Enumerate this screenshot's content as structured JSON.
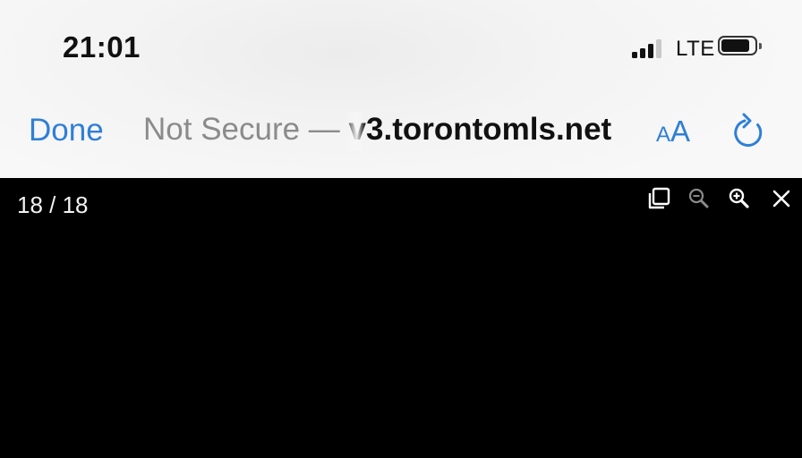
{
  "status_bar": {
    "time": "21:01",
    "network": "LTE",
    "signal_level": 3,
    "signal_max": 4,
    "battery_icon": "battery-icon"
  },
  "browser": {
    "done_label": "Done",
    "url_security_text": "Not Secure — ",
    "url_host": "v3.torontomls.net",
    "text_size_small": "A",
    "text_size_large": "A",
    "reload_icon": "reload-icon",
    "accent_color": "#2f7fd6"
  },
  "viewer": {
    "counter": "18 / 18",
    "toolbar_icons": [
      "copy-icon",
      "zoom-out-icon",
      "zoom-in-icon",
      "close-icon"
    ],
    "background_color": "#000000"
  }
}
